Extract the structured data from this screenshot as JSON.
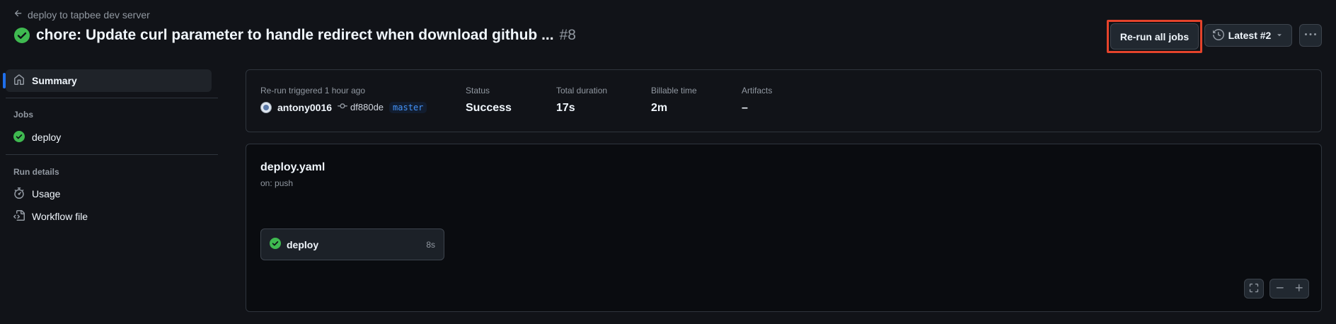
{
  "header": {
    "back_label": "deploy to tapbee dev server",
    "title": "chore: Update curl parameter to handle redirect when download github ...",
    "run_number": "#8",
    "rerun_label": "Re-run all jobs",
    "latest_label": "Latest #2"
  },
  "sidebar": {
    "summary_label": "Summary",
    "jobs_heading": "Jobs",
    "jobs": [
      {
        "label": "deploy"
      }
    ],
    "run_details_heading": "Run details",
    "details": [
      {
        "label": "Usage"
      },
      {
        "label": "Workflow file"
      }
    ]
  },
  "summary": {
    "trigger_label": "Re-run triggered 1 hour ago",
    "actor": "antony0016",
    "commit": "df880de",
    "branch": "master",
    "status_label": "Status",
    "status_value": "Success",
    "duration_label": "Total duration",
    "duration_value": "17s",
    "billable_label": "Billable time",
    "billable_value": "2m",
    "artifacts_label": "Artifacts",
    "artifacts_value": "–"
  },
  "workflow": {
    "file": "deploy.yaml",
    "trigger": "on: push",
    "jobs": [
      {
        "name": "deploy",
        "duration": "8s"
      }
    ]
  },
  "colors": {
    "success": "#3fb950",
    "accent": "#1f6feb",
    "highlight": "#e5432b"
  }
}
